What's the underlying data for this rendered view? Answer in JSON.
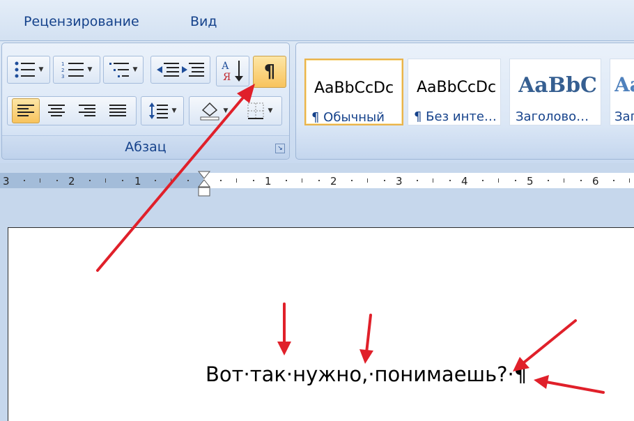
{
  "tabs": [
    {
      "label": "Рецензирование"
    },
    {
      "label": "Вид"
    }
  ],
  "paragraph_group": {
    "label": "Абзац",
    "launcher_icon": "dialog-launcher-icon",
    "show_marks_label": "¶",
    "sort_label_top": "А",
    "sort_label_bottom": "Я",
    "show_marks_active": true,
    "align_left_active": true
  },
  "styles_gallery": {
    "items": [
      {
        "sample": "AaBbCcDc",
        "name": "¶ Обычный",
        "selected": true
      },
      {
        "sample": "AaBbCcDc",
        "name": "¶ Без инте…",
        "selected": false
      },
      {
        "sample": "AaBbC",
        "name": "Заголово…",
        "selected": false
      },
      {
        "sample": "Aa",
        "name": "Заг",
        "selected": false
      }
    ]
  },
  "ruler": {
    "left_numbers": [
      "3",
      "2",
      "1"
    ],
    "right_numbers": [
      "1",
      "2",
      "3",
      "4",
      "5",
      "6"
    ]
  },
  "document": {
    "text": "Вот·так·нужно,·понимаешь?·¶"
  },
  "colors": {
    "annotation_arrow": "#e0202a",
    "active_button": "#f8c35d",
    "ribbon_text": "#15428b"
  }
}
